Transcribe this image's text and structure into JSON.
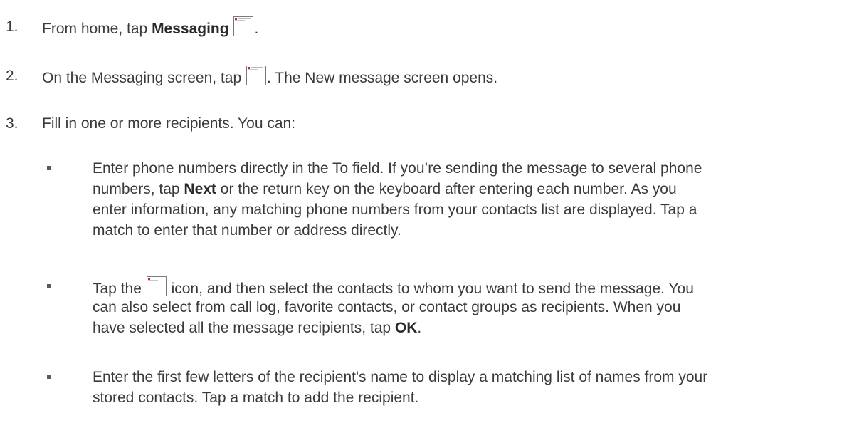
{
  "steps": [
    {
      "number": "1.",
      "pre": "From home, tap ",
      "bold": "Messaging",
      "post": ".",
      "icon": "messaging-icon"
    },
    {
      "number": "2.",
      "pre": "On the Messaging screen, tap ",
      "post": ". The New message screen opens.",
      "icon": "compose-icon"
    },
    {
      "number": "3.",
      "text": "Fill in one or more recipients. You can:"
    }
  ],
  "bullets": [
    {
      "line1": "Enter phone numbers directly in the To field. If you’re sending the message to several phone",
      "line2_pre": "numbers, tap ",
      "line2_bold": "Next",
      "line2_post": " or the return key on the keyboard after entering each number. As you",
      "line3": "enter information, any matching phone numbers from your contacts list are displayed. Tap a",
      "line4": "match to enter that number or address directly."
    },
    {
      "line1_pre": "Tap the ",
      "line1_post": " icon, and then select the contacts to whom you want to send the message. You",
      "line2": "can also select from call log, favorite contacts, or contact groups as recipients. When you",
      "line3_pre": "have selected all the message recipients, tap ",
      "line3_bold": "OK",
      "line3_post": ".",
      "icon": "contacts-icon"
    },
    {
      "line1": "Enter the first few letters of the recipient's name to display a matching list of names from your",
      "line2": "stored contacts. Tap a match to add the recipient."
    }
  ]
}
